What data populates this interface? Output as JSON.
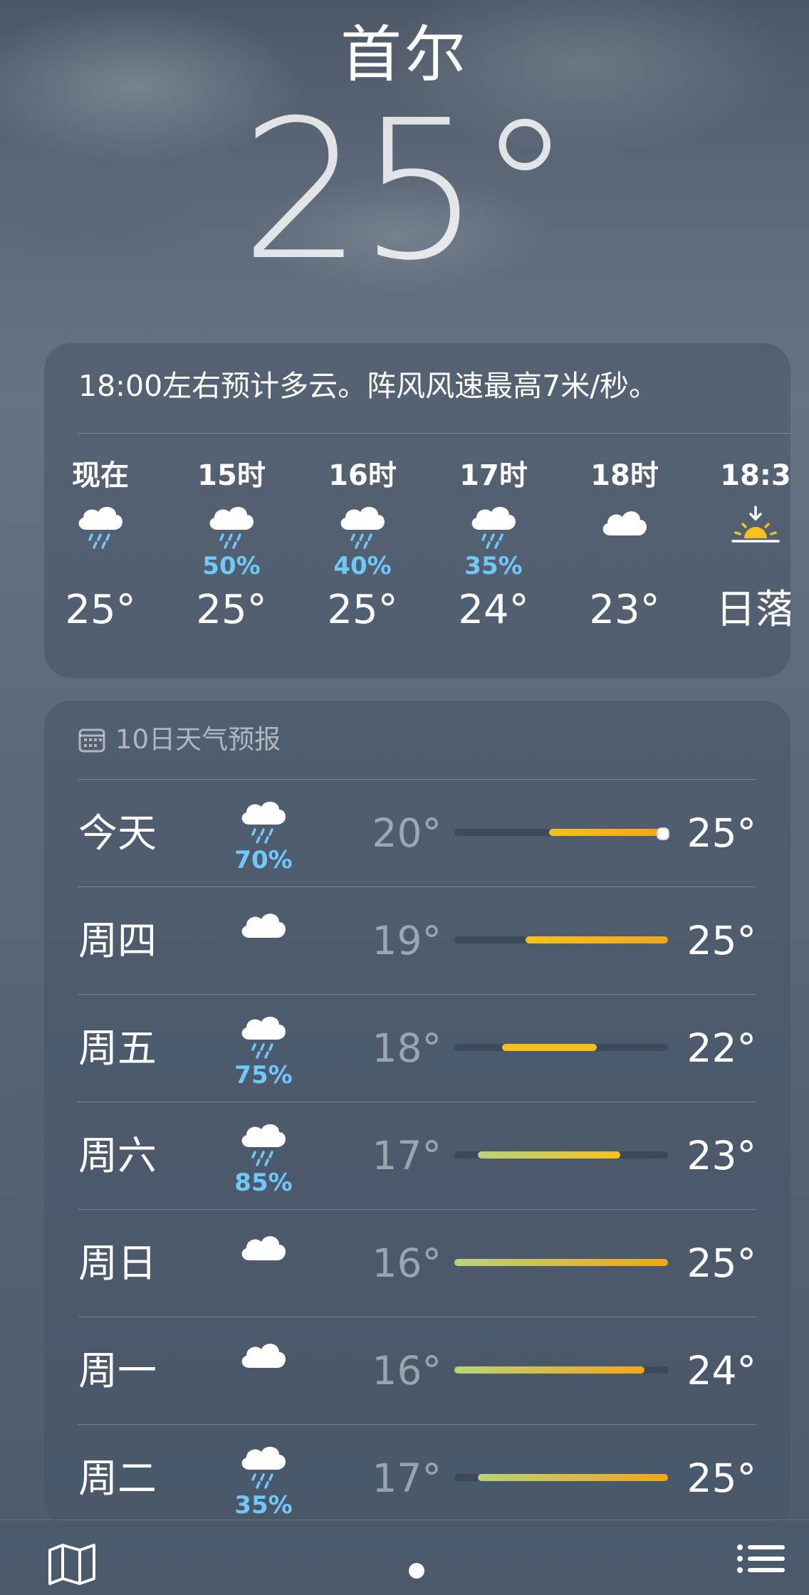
{
  "location": {
    "city": "首尔",
    "temperature": "25°"
  },
  "hourly": {
    "summary": "18:00左右预计多云。阵风风速最高7米/秒。",
    "items": [
      {
        "label": "现在",
        "icon": "cloud-rain-icon",
        "precip": "",
        "temp": "25°"
      },
      {
        "label": "15时",
        "icon": "cloud-rain-icon",
        "precip": "50%",
        "temp": "25°"
      },
      {
        "label": "16时",
        "icon": "cloud-rain-icon",
        "precip": "40%",
        "temp": "25°"
      },
      {
        "label": "17时",
        "icon": "cloud-rain-icon",
        "precip": "35%",
        "temp": "24°"
      },
      {
        "label": "18时",
        "icon": "cloud-icon",
        "precip": "",
        "temp": "23°"
      },
      {
        "label": "18:3",
        "icon": "sunset-icon",
        "precip": "",
        "temp": "日落"
      }
    ]
  },
  "daily": {
    "title": "10日天气预报",
    "range_min": 16,
    "range_max": 25,
    "current_temp": 25,
    "days": [
      {
        "day": "今天",
        "icon": "cloud-rain-icon",
        "precip": "70%",
        "low": "20°",
        "high": "25°",
        "low_val": 20,
        "high_val": 25,
        "is_today": true
      },
      {
        "day": "周四",
        "icon": "cloud-icon",
        "precip": "",
        "low": "19°",
        "high": "25°",
        "low_val": 19,
        "high_val": 25
      },
      {
        "day": "周五",
        "icon": "cloud-rain-icon",
        "precip": "75%",
        "low": "18°",
        "high": "22°",
        "low_val": 18,
        "high_val": 22
      },
      {
        "day": "周六",
        "icon": "cloud-rain-icon",
        "precip": "85%",
        "low": "17°",
        "high": "23°",
        "low_val": 17,
        "high_val": 23
      },
      {
        "day": "周日",
        "icon": "cloud-icon",
        "precip": "",
        "low": "16°",
        "high": "25°",
        "low_val": 16,
        "high_val": 25
      },
      {
        "day": "周一",
        "icon": "cloud-icon",
        "precip": "",
        "low": "16°",
        "high": "24°",
        "low_val": 16,
        "high_val": 24
      },
      {
        "day": "周二",
        "icon": "cloud-rain-icon",
        "precip": "35%",
        "low": "17°",
        "high": "25°",
        "low_val": 17,
        "high_val": 25
      }
    ]
  },
  "bottom_bar": {
    "left_icon": "map-icon",
    "center_icon": "page-indicator",
    "right_icon": "list-icon"
  },
  "colors": {
    "precip": "#6fc8f8",
    "bar_cool": "#b9d37a",
    "bar_warm": "#f5c21b",
    "bar_hot": "#f3a51a"
  }
}
